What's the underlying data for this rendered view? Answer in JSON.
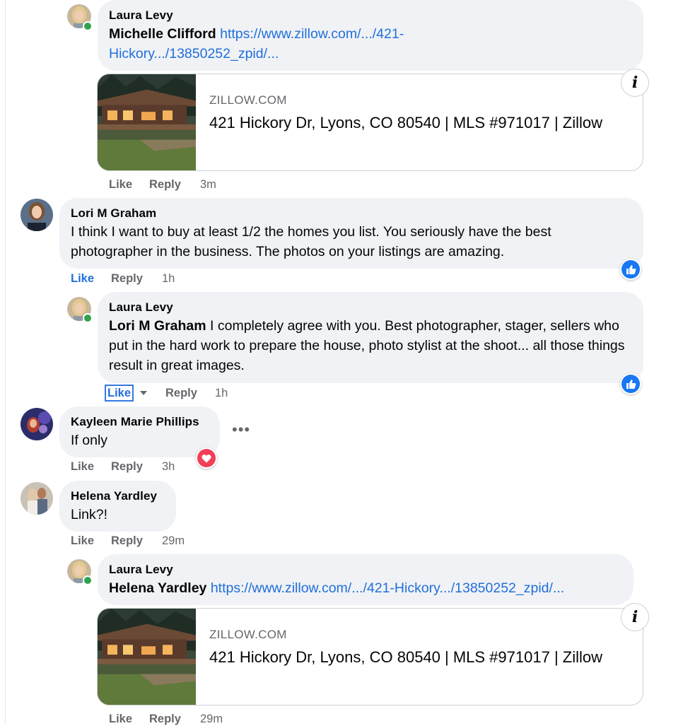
{
  "colors": {
    "bubble_bg": "#f0f2f5",
    "link": "#216fdb",
    "secondary_text": "#65676b",
    "online": "#31a24c",
    "like_blue": "#1877f2",
    "love_red": "#f33e58"
  },
  "comments": [
    {
      "author": "Laura Levy",
      "mention": "Michelle Clifford",
      "link_line1": "https://www.zillow.com/.../421-",
      "link_line2": "Hickory.../13850252_zpid/...",
      "preview": {
        "domain": "ZILLOW.COM",
        "title": "421 Hickory Dr, Lyons, CO 80540 | MLS #971017 | Zillow",
        "thumbnail_icon": "house-photo"
      },
      "actions": {
        "like": "Like",
        "reply": "Reply",
        "time": "3m"
      }
    },
    {
      "author": "Lori M Graham",
      "text": "I think I want to buy at least 1/2 the homes you list. You seriously have the best photographer in the business. The photos on your listings are amazing.",
      "actions": {
        "like": "Like",
        "reply": "Reply",
        "time": "1h"
      },
      "reaction_icon": "like-reaction-icon"
    },
    {
      "author": "Laura Levy",
      "mention": "Lori M Graham",
      "text": " I completely agree with you. Best photographer, stager, sellers who put in the hard work to prepare the house, photo stylist at the shoot... all those things result in great images.",
      "actions": {
        "like": "Like",
        "reply": "Reply",
        "time": "1h"
      },
      "reaction_icon": "like-reaction-icon"
    },
    {
      "author": "Kayleen Marie Phillips",
      "text": "If only",
      "more_icon": "more-options-icon",
      "actions": {
        "like": "Like",
        "reply": "Reply",
        "time": "3h"
      },
      "reaction_icon": "love-reaction-icon"
    },
    {
      "author": "Helena Yardley",
      "text": "Link?!",
      "actions": {
        "like": "Like",
        "reply": "Reply",
        "time": "29m"
      }
    },
    {
      "author": "Laura Levy",
      "mention": "Helena Yardley",
      "link": "https://www.zillow.com/.../421-Hickory.../13850252_zpid/...",
      "preview": {
        "domain": "ZILLOW.COM",
        "title": "421 Hickory Dr, Lyons, CO 80540 | MLS #971017 | Zillow",
        "thumbnail_icon": "house-photo"
      },
      "actions": {
        "like": "Like",
        "reply": "Reply",
        "time": "29m"
      }
    }
  ]
}
